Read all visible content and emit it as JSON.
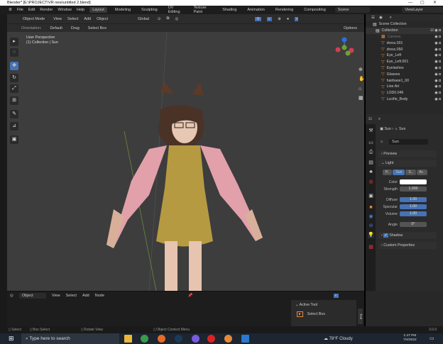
{
  "window": {
    "title": "Blender* [E:\\PROJECT\\VR new\\untitled 2.blend]",
    "minimize": "—",
    "maximize": "▢",
    "close": "✕"
  },
  "menu": [
    "File",
    "Edit",
    "Render",
    "Window",
    "Help"
  ],
  "workspaces": [
    "Layout",
    "Modeling",
    "Sculpting",
    "UV Editing",
    "Texture Paint",
    "Shading",
    "Animation",
    "Rendering",
    "Compositing"
  ],
  "scene": "Scene",
  "view_layer": "ViewLayer",
  "viewport_header": {
    "mode": "Object Mode",
    "menus": [
      "View",
      "Select",
      "Add",
      "Object"
    ],
    "transform": "Global",
    "options": "Options"
  },
  "tool_settings": {
    "orientation_label": "Orientation:",
    "orientation": "Default",
    "drag_label": "Drag",
    "drag": "Select Box"
  },
  "viewport": {
    "perspective": "User Perspective",
    "collection": "(1) Collection | Sun"
  },
  "outliner": {
    "scene_collection": "Scene Collection",
    "collection": "Collection",
    "items": [
      "Camera",
      "dress.001",
      "dress.050",
      "Eye_Left",
      "Eye_Left.001",
      "Eyelashes",
      "Glasses",
      "hairbase1_00",
      "Line Art",
      "LOD0.046",
      "Lucifie_Body"
    ]
  },
  "properties": {
    "breadcrumb_obj": "Sun",
    "breadcrumb_data": "Sun",
    "data_name": "Sun",
    "preview": "Preview",
    "light": "Light",
    "light_types": [
      "P..",
      "Sun",
      "S..",
      "Ar.."
    ],
    "color_label": "Color",
    "color": "#ffffff",
    "strength_label": "Strength",
    "strength": "1.000",
    "diffuse_label": "Diffuse",
    "diffuse": "1.00",
    "specular_label": "Specular",
    "specular": "1.00",
    "volume_label": "Volume",
    "volume": "1.00",
    "angle_label": "Angle",
    "angle": "0°",
    "shadow": "Shadow",
    "custom_properties": "Custom Properties"
  },
  "node_editor": {
    "type": "Object",
    "menus": [
      "View",
      "Select",
      "Add",
      "Node"
    ],
    "active_tool": "Active Tool",
    "tool": "Select Box",
    "tab": "Tool"
  },
  "statusbar": {
    "select": "Select",
    "box_select": "Box Select",
    "rotate": "Rotate View",
    "context": "Object Context Menu",
    "version": "3.0.0"
  },
  "taskbar": {
    "search": "Type here to search",
    "weather": "78°F  Cloudy",
    "time": "1:47 PM",
    "date": "7/4/2022"
  }
}
